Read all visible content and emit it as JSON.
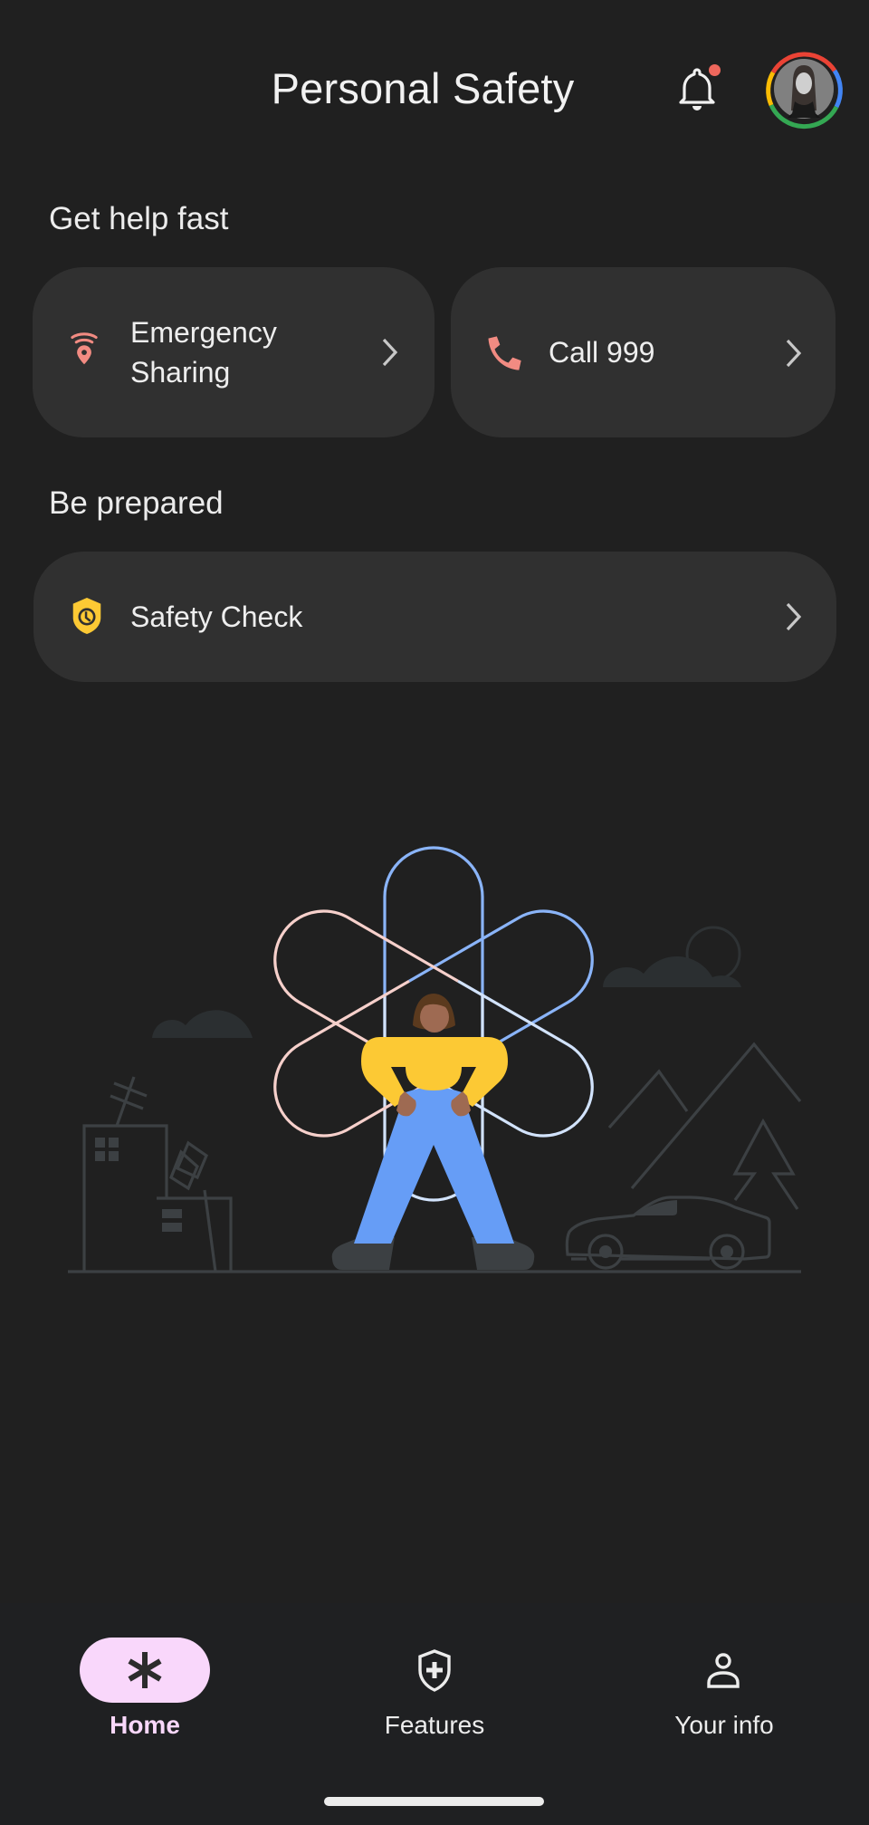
{
  "header": {
    "title": "Personal Safety",
    "notifications_icon": "bell-icon",
    "has_unread_notification": true,
    "avatar_icon": "account-avatar"
  },
  "sections": [
    {
      "title": "Get help fast",
      "cards": [
        {
          "label": "Emergency Sharing",
          "label_lines": [
            "Emergency",
            "Sharing"
          ],
          "icon": "location-broadcast-icon",
          "icon_color": "#f28b82"
        },
        {
          "label": "Call 999",
          "icon": "phone-icon",
          "icon_color": "#f28b82"
        }
      ]
    },
    {
      "title": "Be prepared",
      "cards": [
        {
          "label": "Safety Check",
          "icon": "shield-clock-icon",
          "icon_color": "#fcc934"
        }
      ]
    }
  ],
  "illustration": {
    "description": "Person standing in front of a large asterisk outline with city, mountains, trees and car",
    "colors": {
      "asterisk_blue": "#8ab4f8",
      "asterisk_pink": "#f6d0cb",
      "asterisk_light": "#d2e3fc",
      "shirt": "#fcc934",
      "pants": "#669df6",
      "skin": "#9e6a52",
      "hair": "#5b3a1e",
      "scenery": "#3c4043",
      "cloud": "#2b2f31"
    }
  },
  "bottom_nav": {
    "items": [
      {
        "label": "Home",
        "icon": "asterisk-icon",
        "active": true
      },
      {
        "label": "Features",
        "icon": "shield-plus-icon",
        "active": false
      },
      {
        "label": "Your info",
        "icon": "person-icon",
        "active": false
      }
    ],
    "active_color": "#f9d7fb"
  }
}
